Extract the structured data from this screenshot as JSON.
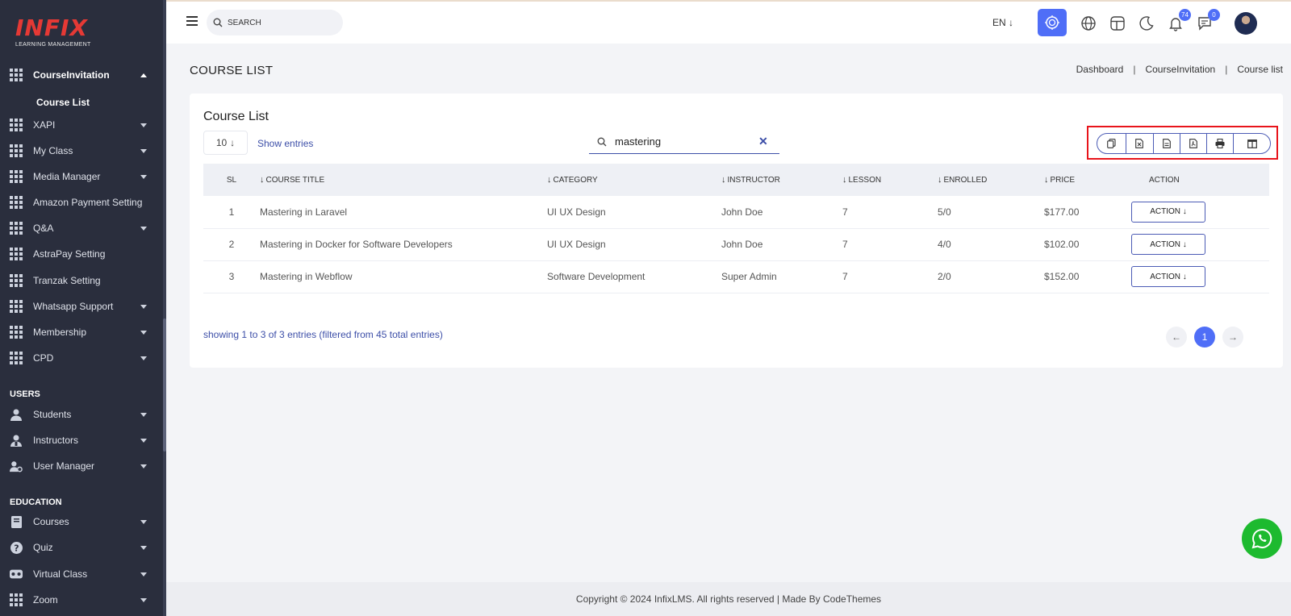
{
  "logo": {
    "word": "INFIX",
    "subtitle": "LEARNING MANAGEMENT"
  },
  "sidebar": {
    "top_items": [
      {
        "label": "CourseInvitation",
        "icon": "grid-icon",
        "expanded": true
      },
      {
        "label": "XAPI",
        "icon": "grid-icon"
      },
      {
        "label": "My Class",
        "icon": "grid-icon"
      },
      {
        "label": "Media Manager",
        "icon": "grid-icon"
      },
      {
        "label": "Amazon Payment Setting",
        "icon": "grid-icon"
      },
      {
        "label": "Q&A",
        "icon": "grid-icon"
      },
      {
        "label": "AstraPay Setting",
        "icon": "grid-icon"
      },
      {
        "label": "Tranzak Setting",
        "icon": "grid-icon"
      },
      {
        "label": "Whatsapp Support",
        "icon": "grid-icon"
      },
      {
        "label": "Membership",
        "icon": "grid-icon"
      },
      {
        "label": "CPD",
        "icon": "grid-icon"
      }
    ],
    "sub_item": "Course List",
    "users_section": "USERS",
    "users_items": [
      {
        "label": "Students",
        "icon": "user-icon"
      },
      {
        "label": "Instructors",
        "icon": "instructor-icon"
      },
      {
        "label": "User Manager",
        "icon": "user-gear-icon"
      }
    ],
    "education_section": "EDUCATION",
    "education_items": [
      {
        "label": "Courses",
        "icon": "book-icon"
      },
      {
        "label": "Quiz",
        "icon": "question-icon"
      },
      {
        "label": "Virtual Class",
        "icon": "vr-icon"
      },
      {
        "label": "Zoom",
        "icon": "grid-icon"
      }
    ]
  },
  "header": {
    "search_placeholder": "SEARCH",
    "language": "EN",
    "notifications_count": "74",
    "messages_count": "0"
  },
  "page": {
    "title": "COURSE LIST",
    "breadcrumb": [
      "Dashboard",
      "CourseInvitation",
      "Course list"
    ]
  },
  "card": {
    "title": "Course List",
    "entries_value": "10",
    "show_entries_label": "Show entries",
    "search_value": "mastering",
    "columns": [
      "SL",
      "COURSE TITLE",
      "CATEGORY",
      "INSTRUCTOR",
      "LESSON",
      "ENROLLED",
      "PRICE",
      "ACTION"
    ],
    "rows": [
      {
        "sl": "1",
        "title": "Mastering in Laravel",
        "category": "UI UX Design",
        "instructor": "John Doe",
        "lesson": "7",
        "enrolled": "5/0",
        "price": "$177.00",
        "action": "ACTION"
      },
      {
        "sl": "2",
        "title": "Mastering in Docker for Software Developers",
        "category": "UI UX Design",
        "instructor": "John Doe",
        "lesson": "7",
        "enrolled": "4/0",
        "price": "$102.00",
        "action": "ACTION"
      },
      {
        "sl": "3",
        "title": "Mastering in Webflow",
        "category": "Software Development",
        "instructor": "Super Admin",
        "lesson": "7",
        "enrolled": "2/0",
        "price": "$152.00",
        "action": "ACTION"
      }
    ],
    "showing_text": "showing 1 to 3 of 3 entries (filtered from 45 total entries)",
    "current_page": "1"
  },
  "footer": {
    "text": "Copyright © 2024 InfixLMS. All rights reserved | Made By CodeThemes"
  },
  "colors": {
    "sidebar_bg": "#2a2e3d",
    "accent": "#4f6ef7",
    "logo_red": "#e53935",
    "highlight_box": "#e8141b",
    "whatsapp_green": "#1dba2f"
  }
}
